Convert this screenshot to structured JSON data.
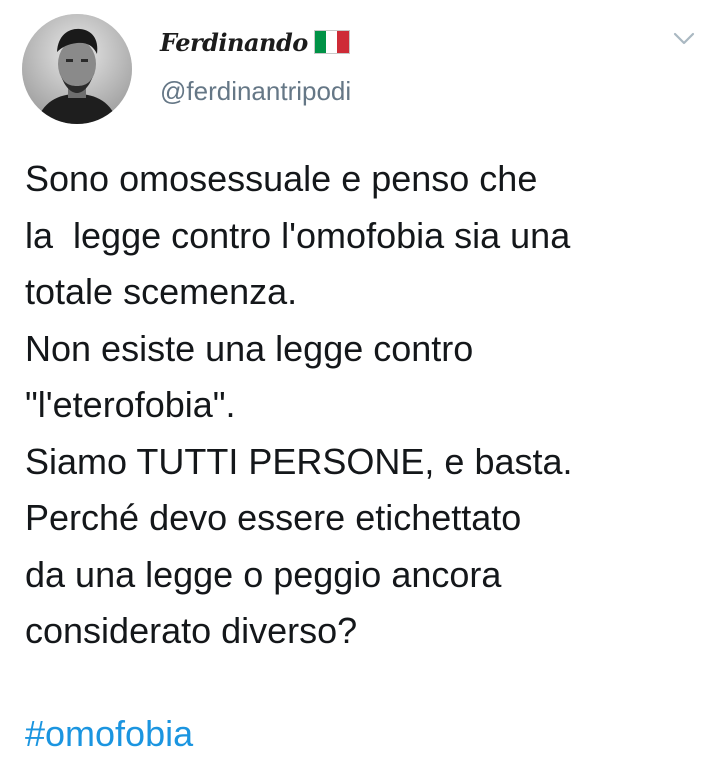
{
  "tweet": {
    "display_name": "Ferdinando",
    "flag_icon": "italy-flag-icon",
    "flag_colors": [
      "#009246",
      "#ffffff",
      "#ce2b37"
    ],
    "handle": "@ferdinantripodi",
    "menu_icon": "chevron-down-icon",
    "body_lines": [
      "Sono omosessuale e penso che",
      "la  legge contro l'omofobia sia una",
      "totale scemenza.",
      "Non esiste una legge contro",
      "\"l'eterofobia\".",
      "Siamo TUTTI PERSONE, e basta.",
      "Perché devo essere etichettato",
      "da una legge o peggio ancora",
      "considerato diverso?"
    ],
    "hashtag": "#omofobia"
  },
  "colors": {
    "text": "#14171a",
    "secondary": "#657786",
    "link": "#1b95e0"
  }
}
